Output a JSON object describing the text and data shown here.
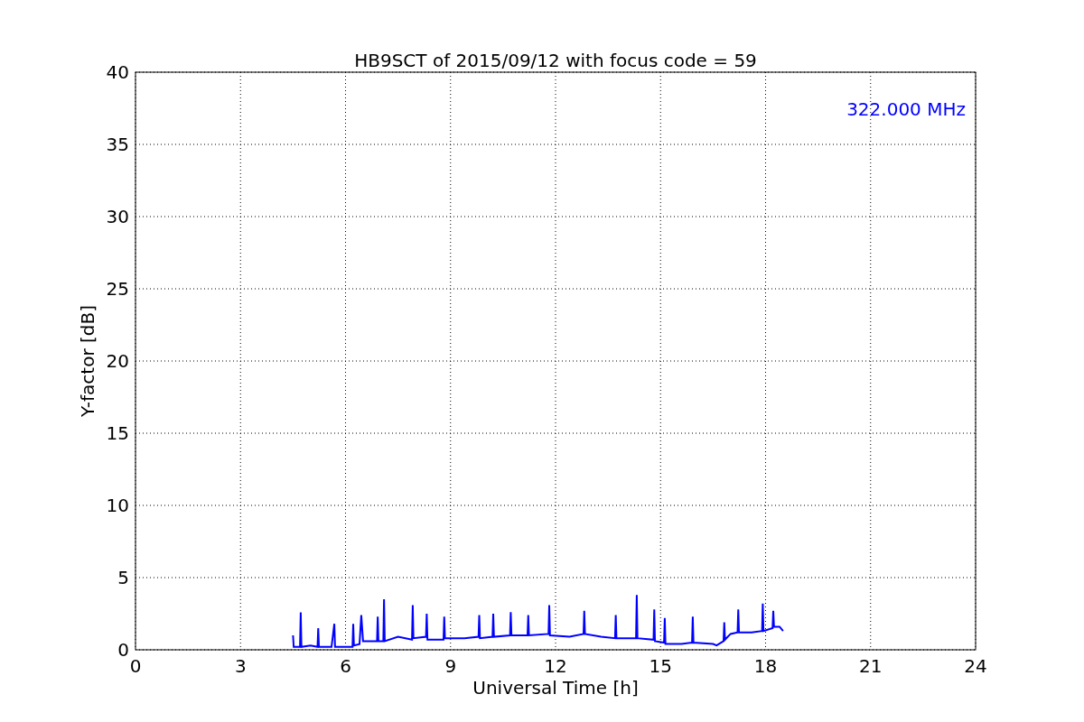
{
  "chart_data": {
    "type": "line",
    "title": "HB9SCT of 2015/09/12 with focus code = 59",
    "xlabel": "Universal Time [h]",
    "ylabel": "Y-factor [dB]",
    "xlim": [
      0,
      24
    ],
    "ylim": [
      0,
      40
    ],
    "xticks": [
      0,
      3,
      6,
      9,
      12,
      15,
      18,
      21,
      24
    ],
    "yticks": [
      0,
      5,
      10,
      15,
      20,
      25,
      30,
      35,
      40
    ],
    "x": [
      4.5,
      4.52,
      4.7,
      4.72,
      4.74,
      5.0,
      5.2,
      5.22,
      5.24,
      5.6,
      5.68,
      5.7,
      6.0,
      6.2,
      6.22,
      6.24,
      6.4,
      6.45,
      6.5,
      6.9,
      6.92,
      6.94,
      7.08,
      7.1,
      7.12,
      7.5,
      7.9,
      7.92,
      7.94,
      8.3,
      8.32,
      8.34,
      8.8,
      8.82,
      8.84,
      9.4,
      9.8,
      9.82,
      9.84,
      10.2,
      10.22,
      10.24,
      10.7,
      10.72,
      10.74,
      11.2,
      11.22,
      11.24,
      11.8,
      11.82,
      11.84,
      12.4,
      12.8,
      12.82,
      12.84,
      13.3,
      13.7,
      13.72,
      13.74,
      14.3,
      14.32,
      14.34,
      14.8,
      14.82,
      14.84,
      15.1,
      15.12,
      15.14,
      15.6,
      15.9,
      15.92,
      15.94,
      16.5,
      16.6,
      16.8,
      16.82,
      16.84,
      17.0,
      17.2,
      17.22,
      17.24,
      17.6,
      17.9,
      17.92,
      17.94,
      18.2,
      18.22,
      18.24,
      18.4,
      18.5
    ],
    "series": [
      {
        "name": "322.000 MHz",
        "color": "#0000ff",
        "values": [
          1.0,
          0.2,
          0.2,
          2.6,
          0.2,
          0.3,
          0.2,
          1.5,
          0.2,
          0.2,
          1.8,
          0.2,
          0.2,
          0.2,
          1.8,
          0.3,
          0.4,
          2.4,
          0.6,
          0.6,
          2.3,
          0.6,
          0.6,
          3.5,
          0.6,
          0.9,
          0.7,
          3.1,
          0.8,
          0.9,
          2.5,
          0.7,
          0.7,
          2.3,
          0.8,
          0.8,
          0.9,
          2.4,
          0.8,
          0.9,
          2.5,
          0.9,
          1.0,
          2.6,
          1.0,
          1.0,
          2.4,
          1.0,
          1.1,
          3.1,
          1.0,
          0.9,
          1.1,
          2.7,
          1.1,
          0.9,
          0.8,
          2.4,
          0.8,
          0.8,
          3.8,
          0.8,
          0.7,
          2.8,
          0.6,
          0.5,
          2.2,
          0.4,
          0.4,
          0.5,
          2.3,
          0.5,
          0.4,
          0.3,
          0.6,
          1.9,
          0.7,
          1.1,
          1.2,
          2.8,
          1.2,
          1.2,
          1.3,
          3.2,
          1.3,
          1.5,
          2.7,
          1.6,
          1.6,
          1.3
        ]
      }
    ],
    "grid": true
  }
}
